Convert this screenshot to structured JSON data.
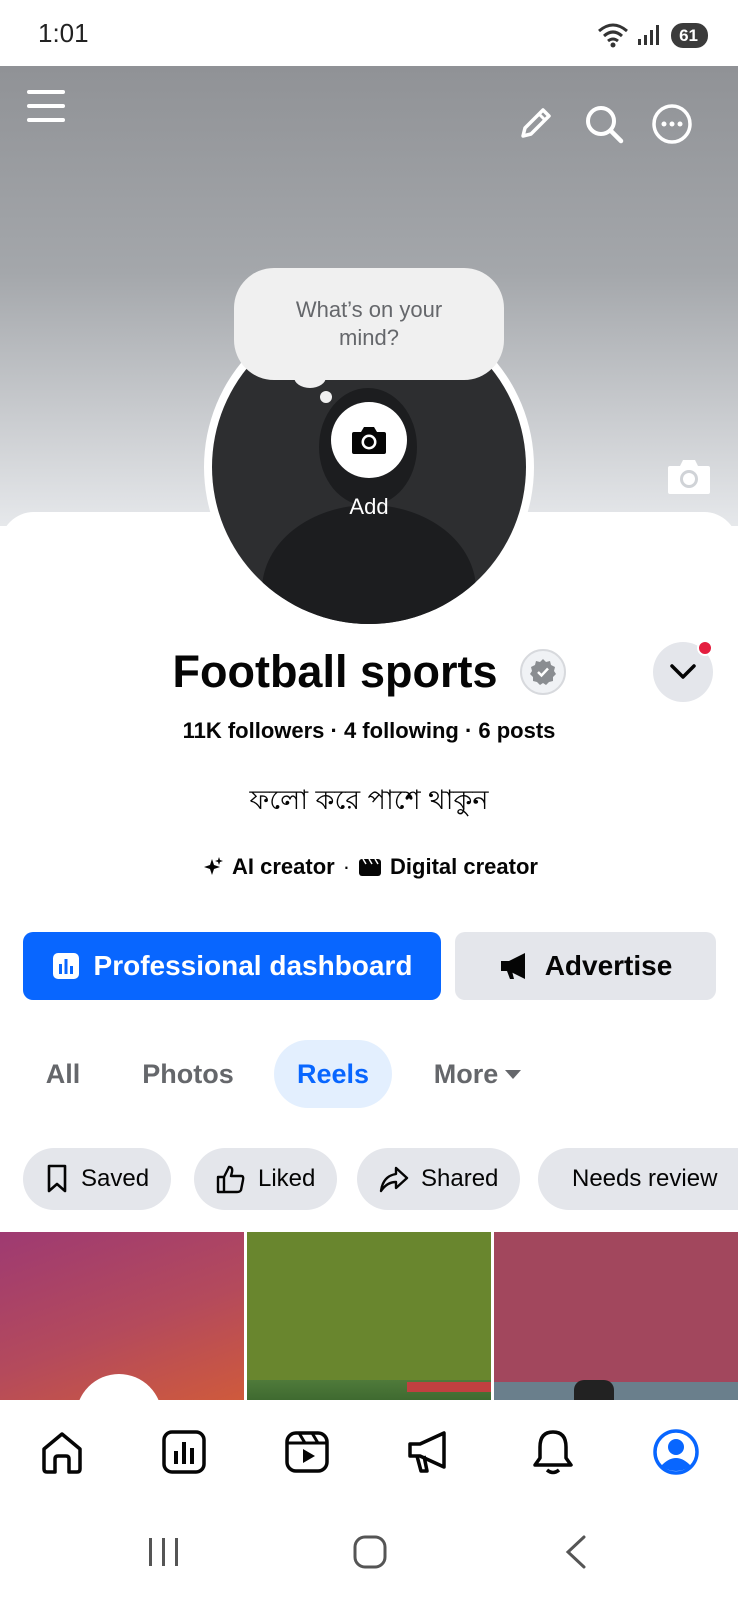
{
  "status_bar": {
    "time": "1:01",
    "battery": "61"
  },
  "cover": {
    "menu_icon": "hamburger-menu-icon",
    "edit_icon": "pencil-icon",
    "search_icon": "search-icon",
    "more_icon": "more-horizontal-icon",
    "camera_icon": "camera-icon"
  },
  "avatar": {
    "thought_bubble": "What’s on your mind?",
    "add_label": "Add"
  },
  "profile": {
    "name": "Football sports",
    "stats": "11K followers · 4 following · 6 posts",
    "bio": "ফলো করে পাশে থাকুন",
    "categories": [
      {
        "label": "AI creator",
        "icon": "sparkle-icon"
      },
      {
        "label": "Digital creator",
        "icon": "clapperboard-icon"
      }
    ],
    "category_separator": "·"
  },
  "buttons": {
    "professional_dashboard": "Professional dashboard",
    "advertise": "Advertise"
  },
  "tabs": [
    {
      "label": "All",
      "active": false
    },
    {
      "label": "Photos",
      "active": false
    },
    {
      "label": "Reels",
      "active": true
    },
    {
      "label": "More",
      "active": false
    }
  ],
  "chips": [
    {
      "label": "Saved",
      "icon": "bookmark-icon"
    },
    {
      "label": "Liked",
      "icon": "thumbs-up-icon"
    },
    {
      "label": "Shared",
      "icon": "share-icon"
    },
    {
      "label": "Needs review",
      "icon": "eye-icon"
    }
  ],
  "bottom_nav": [
    {
      "name": "home",
      "icon": "home-icon",
      "active": false
    },
    {
      "name": "dashboard",
      "icon": "dashboard-icon",
      "active": false
    },
    {
      "name": "video",
      "icon": "video-icon",
      "active": false
    },
    {
      "name": "ads",
      "icon": "megaphone-icon",
      "active": false
    },
    {
      "name": "notifications",
      "icon": "bell-icon",
      "active": false
    },
    {
      "name": "profile",
      "icon": "profile-icon",
      "active": true
    }
  ],
  "colors": {
    "primary": "#0866ff",
    "tab_active_bg": "#e3effe",
    "chip_bg": "#e4e6eb",
    "notification_dot": "#e41e3f"
  }
}
